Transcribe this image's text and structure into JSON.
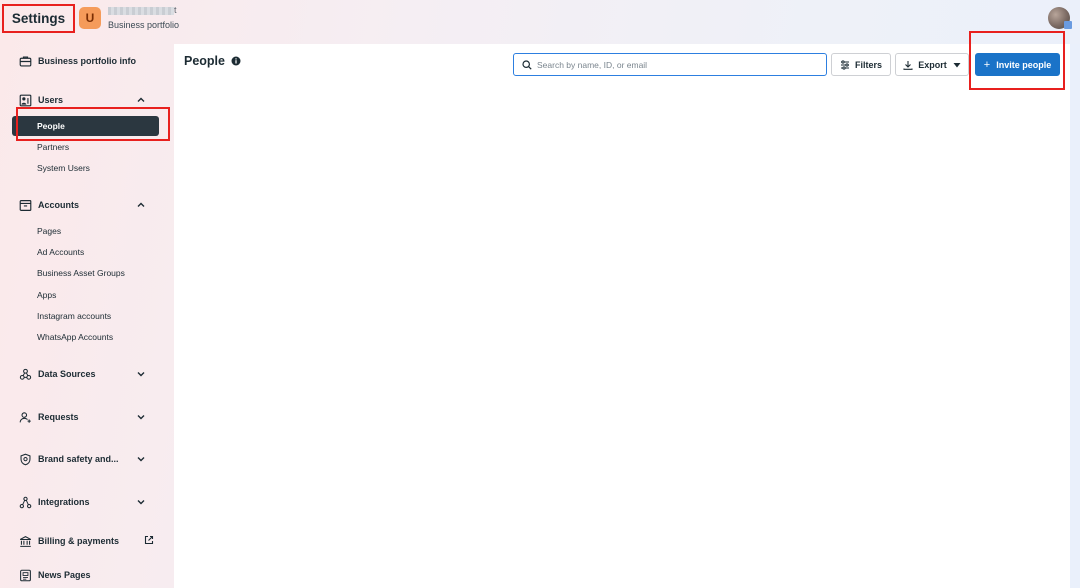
{
  "header": {
    "title": "Settings",
    "portfolio_initial": "U",
    "portfolio_name_visible": "t",
    "portfolio_subtitle": "Business portfolio"
  },
  "sidebar": {
    "business_info": "Business portfolio info",
    "users": {
      "label": "Users",
      "items": [
        "People",
        "Partners",
        "System Users"
      ]
    },
    "accounts": {
      "label": "Accounts",
      "items": [
        "Pages",
        "Ad Accounts",
        "Business Asset Groups",
        "Apps",
        "Instagram accounts",
        "WhatsApp Accounts"
      ]
    },
    "data_sources": "Data Sources",
    "requests": "Requests",
    "brand_safety": "Brand safety and...",
    "integrations": "Integrations",
    "billing": "Billing & payments",
    "news_pages": "News Pages"
  },
  "main": {
    "title": "People",
    "search_placeholder": "Search by name, ID, or email",
    "filters_label": "Filters",
    "export_label": "Export",
    "invite_label": "Invite people"
  },
  "colors": {
    "accent": "#1a73c8",
    "active_nav": "#2b3740",
    "annotation": "#e8201e"
  }
}
